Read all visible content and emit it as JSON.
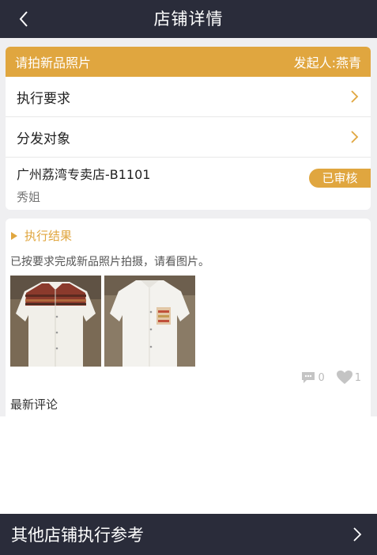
{
  "header": {
    "title": "店铺详情"
  },
  "task": {
    "title": "请拍新品照片",
    "initiator": "发起人:燕青",
    "rows": [
      {
        "label": "执行要求"
      },
      {
        "label": "分发对象"
      }
    ],
    "store": {
      "name": "广州荔湾专卖店-B1101",
      "owner": "秀姐",
      "status": "已审核"
    }
  },
  "result": {
    "heading": "执行结果",
    "description": "已按要求完成新品照片拍摄，请看图片。",
    "comments": "0",
    "likes": "1",
    "latest_comments_label": "最新评论"
  },
  "footer": {
    "label": "其他店铺执行参考"
  },
  "colors": {
    "accent": "#e0a63f",
    "dark": "#2a2c3a"
  }
}
